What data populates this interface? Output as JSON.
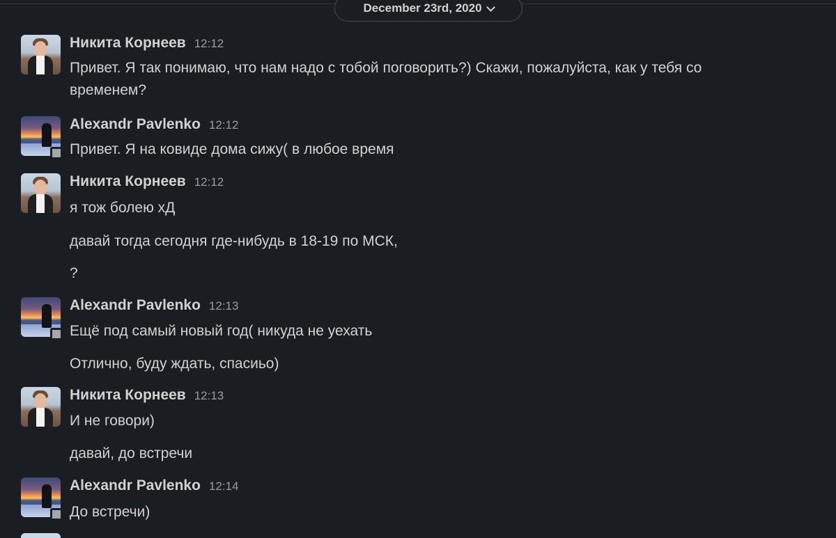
{
  "date_divider": {
    "label": "December 23rd, 2020"
  },
  "messages": [
    {
      "author": "Никита Корнеев",
      "time": "12:12",
      "avatar": "nikita",
      "lines": [
        "Привет. Я так понимаю, что нам надо с тобой поговорить?) Скажи, пожалуйста, как у тебя со",
        "временем?"
      ]
    },
    {
      "author": "Alexandr Pavlenko",
      "time": "12:12",
      "avatar": "alexandr",
      "lines": [
        "Привет. Я на ковиде дома сижу( в любое время"
      ]
    },
    {
      "author": "Никита Корнеев",
      "time": "12:12",
      "avatar": "nikita",
      "lines": [
        "я тож болею хД",
        "давай тогда сегодня где-нибудь в 18-19 по МСК,",
        "?"
      ]
    },
    {
      "author": "Alexandr Pavlenko",
      "time": "12:13",
      "avatar": "alexandr",
      "lines": [
        "Ещё под самый новый год( никуда не уехать",
        "Отлично, буду ждать, спасиьо)"
      ]
    },
    {
      "author": "Никита Корнеев",
      "time": "12:13",
      "avatar": "nikita",
      "lines": [
        "И не говори)",
        "давай, до встречи"
      ]
    },
    {
      "author": "Alexandr Pavlenko",
      "time": "12:14",
      "avatar": "alexandr",
      "lines": [
        "До встречи)"
      ]
    }
  ],
  "colors": {
    "background": "#1a1d21",
    "text": "#d1d2d3",
    "timestamp": "#9b9c9e",
    "divider": "#35373b",
    "status_indicator": "#a5a7aa"
  }
}
